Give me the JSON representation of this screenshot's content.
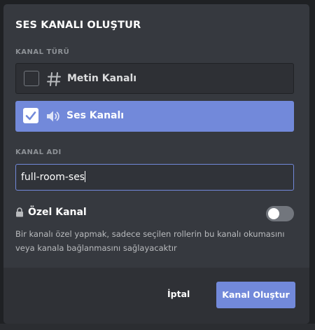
{
  "modal": {
    "title": "SES KANALI OLUŞTUR",
    "channel_type_label": "KANAL TÜRÜ",
    "options": [
      {
        "label": "Metin Kanalı",
        "icon": "hash-icon",
        "selected": false
      },
      {
        "label": "Ses Kanalı",
        "icon": "speaker-icon",
        "selected": true
      }
    ],
    "channel_name_label": "KANAL ADI",
    "channel_name_value": "full-room-ses",
    "private": {
      "label": "Özel Kanal",
      "enabled": false,
      "description": "Bir kanalı özel yapmak, sadece seçilen rollerin bu kanalı okumasını veya kanala bağlanmasını sağlayacaktır"
    },
    "buttons": {
      "cancel": "İptal",
      "create": "Kanal Oluştur"
    }
  },
  "colors": {
    "accent": "#7289da",
    "modal_bg": "#36393f",
    "footer_bg": "#2f3136"
  }
}
